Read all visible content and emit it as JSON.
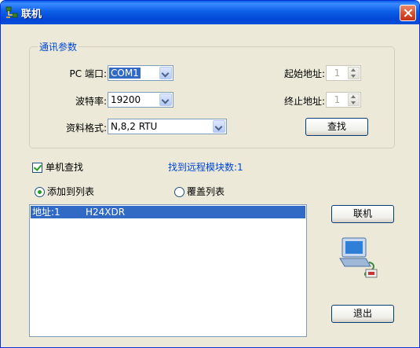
{
  "window": {
    "title": "联机"
  },
  "comm_group": {
    "title": "通讯参数",
    "port_label": "PC 端口:",
    "port_value": "COM1",
    "baud_label": "波特率:",
    "baud_value": "19200",
    "format_label": "资料格式:",
    "format_value": "N,8,2 RTU",
    "start_addr_label": "起始地址:",
    "start_addr_value": "1",
    "end_addr_label": "终止地址:",
    "end_addr_value": "1",
    "search_button": "查找"
  },
  "single_search": {
    "label": "单机查找",
    "checked": true
  },
  "found_status": "找到远程模块数:1",
  "options": {
    "add_to_list": {
      "label": "添加到列表",
      "selected": true
    },
    "overwrite_list": {
      "label": "覆盖列表",
      "selected": false
    }
  },
  "module_list": [
    {
      "address": "地址:1",
      "model": "H24XDR",
      "selected": true
    }
  ],
  "connect_button": "联机",
  "exit_button": "退出",
  "colors": {
    "title_bar": "#0a5ee8",
    "status_text": "#0046d5",
    "selection": "#316ac5"
  }
}
